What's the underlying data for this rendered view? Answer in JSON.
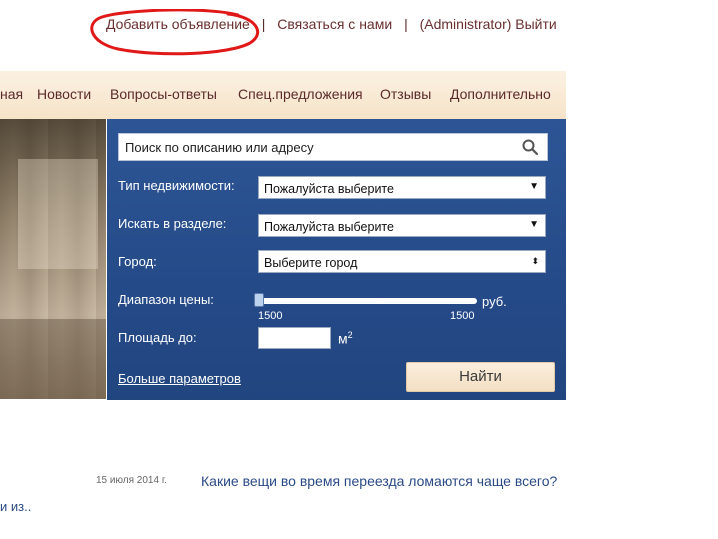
{
  "toplinks": {
    "add_ad": "Добавить объявление",
    "sep": "|",
    "contact": "Связаться с нами",
    "logout": "(Administrator) Выйти"
  },
  "nav": {
    "items": [
      {
        "label": "ная"
      },
      {
        "label": "Новости"
      },
      {
        "label": "Вопросы-ответы"
      },
      {
        "label": "Спец.предложения"
      },
      {
        "label": "Отзывы"
      },
      {
        "label": "Дополнительно"
      }
    ]
  },
  "search": {
    "placeholder": "Поиск по описанию или адресу",
    "icon": "search-icon",
    "property_type_label": "Тип недвижимости:",
    "property_type_value": "Пожалуйста выберите",
    "section_label": "Искать в разделе:",
    "section_value": "Пожалуйста выберите",
    "city_label": "Город:",
    "city_value": "Выберите город",
    "price_label": "Диапазон цены:",
    "price_min": "1500",
    "price_max": "1500",
    "price_unit": "руб.",
    "area_label": "Площадь до:",
    "area_value": "",
    "area_unit": "м",
    "area_unit_sup": "2",
    "more_params": "Больше параметров",
    "find_button": "Найти"
  },
  "news": {
    "date": "15 июля 2014 г.",
    "title": "Какие вещи во время переезда ломаются чаще всего?",
    "snippet": "и из.."
  },
  "colors": {
    "panel": "#2d5595",
    "nav_bg": "#f6e3c8",
    "link": "#6a2f2f",
    "annotation": "#e01818"
  }
}
